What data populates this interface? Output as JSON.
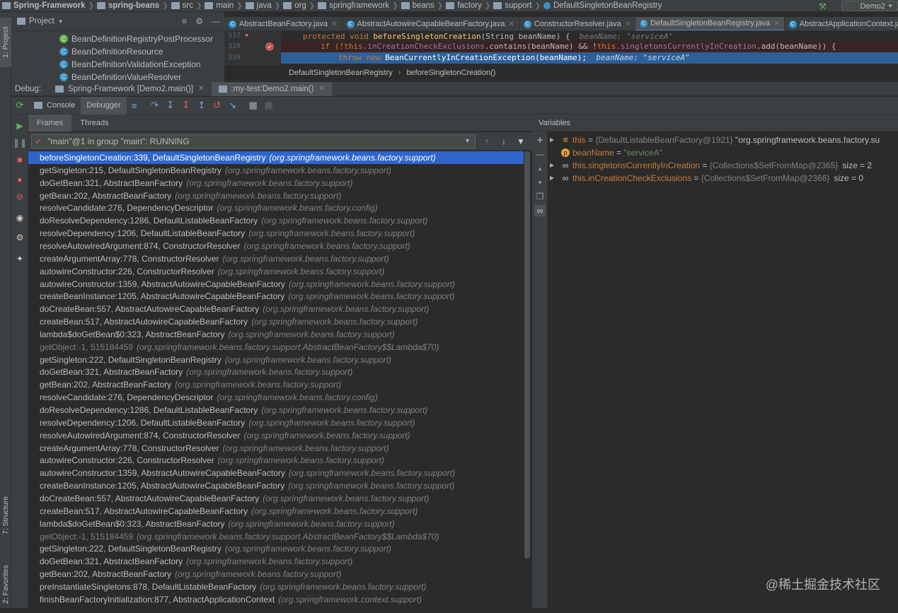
{
  "navbar": {
    "crumbs": [
      "Spring-Framework",
      "spring-beans",
      "src",
      "main",
      "java",
      "org",
      "springframework",
      "beans",
      "factory",
      "support",
      "DefaultSingletonBeanRegistry"
    ],
    "run_config": "Demo2"
  },
  "left_strip": {
    "project_tab": "1: Project",
    "structure_tab": "7: Structure",
    "favorites_tab": "2: Favorites"
  },
  "project": {
    "title": "Project",
    "tree": [
      {
        "label": "BeanDefinitionRegistryPostProcessor",
        "color": "#62b543"
      },
      {
        "label": "BeanDefinitionResource",
        "color": "#3592c4"
      },
      {
        "label": "BeanDefinitionValidationException",
        "color": "#3592c4"
      },
      {
        "label": "BeanDefinitionValueResolver",
        "color": "#3592c4"
      }
    ]
  },
  "tabs": [
    {
      "label": "AbstractBeanFactory.java"
    },
    {
      "label": "AbstractAutowireCapableBeanFactory.java"
    },
    {
      "label": "ConstructorResolver.java"
    },
    {
      "label": "DefaultSingletonBeanRegistry.java",
      "active": true
    },
    {
      "label": "AbstractApplicationContext.java"
    }
  ],
  "editor": {
    "lines": [
      {
        "num": "337",
        "text_kw": "protected void ",
        "text_fn": "beforeSingletonCreation",
        "text_rest": "(String beanName) {  ",
        "hint": "beanName: \"serviceA\""
      },
      {
        "num": "338",
        "part1": "if (!",
        "f1": "this",
        "f1b": ".inCreationCheckExclusions",
        "part2": ".contains(beanName) && !",
        "f2": "this",
        "f2b": ".singletonsCurrentlyInCreation",
        "part3": ".add(beanName)) {"
      },
      {
        "num": "339",
        "kw": "throw new ",
        "rest": "BeanCurrentlyInCreationException(beanName);  ",
        "hint": "beanName: \"serviceA\""
      }
    ],
    "breadcrumb": [
      "DefaultSingletonBeanRegistry",
      "beforeSingletonCreation()"
    ]
  },
  "debug": {
    "label": "Debug:",
    "sessions": [
      {
        "label": "Spring-Framework [Demo2.main()]"
      },
      {
        "label": ":my-test:Demo2.main()"
      }
    ],
    "toolbar": {
      "console": "Console",
      "debugger": "Debugger"
    },
    "frames_tab": "Frames",
    "threads_tab": "Threads",
    "thread": "\"main\"@1 in group \"main\": RUNNING",
    "frames": [
      {
        "m": "beforeSingletonCreation:339, DefaultSingletonBeanRegistry",
        "p": "(org.springframework.beans.factory.support)",
        "sel": true
      },
      {
        "m": "getSingleton:215, DefaultSingletonBeanRegistry",
        "p": "(org.springframework.beans.factory.support)"
      },
      {
        "m": "doGetBean:321, AbstractBeanFactory",
        "p": "(org.springframework.beans.factory.support)"
      },
      {
        "m": "getBean:202, AbstractBeanFactory",
        "p": "(org.springframework.beans.factory.support)"
      },
      {
        "m": "resolveCandidate:276, DependencyDescriptor",
        "p": "(org.springframework.beans.factory.config)"
      },
      {
        "m": "doResolveDependency:1286, DefaultListableBeanFactory",
        "p": "(org.springframework.beans.factory.support)"
      },
      {
        "m": "resolveDependency:1206, DefaultListableBeanFactory",
        "p": "(org.springframework.beans.factory.support)"
      },
      {
        "m": "resolveAutowiredArgument:874, ConstructorResolver",
        "p": "(org.springframework.beans.factory.support)"
      },
      {
        "m": "createArgumentArray:778, ConstructorResolver",
        "p": "(org.springframework.beans.factory.support)"
      },
      {
        "m": "autowireConstructor:226, ConstructorResolver",
        "p": "(org.springframework.beans.factory.support)"
      },
      {
        "m": "autowireConstructor:1359, AbstractAutowireCapableBeanFactory",
        "p": "(org.springframework.beans.factory.support)"
      },
      {
        "m": "createBeanInstance:1205, AbstractAutowireCapableBeanFactory",
        "p": "(org.springframework.beans.factory.support)"
      },
      {
        "m": "doCreateBean:557, AbstractAutowireCapableBeanFactory",
        "p": "(org.springframework.beans.factory.support)"
      },
      {
        "m": "createBean:517, AbstractAutowireCapableBeanFactory",
        "p": "(org.springframework.beans.factory.support)"
      },
      {
        "m": "lambda$doGetBean$0:323, AbstractBeanFactory",
        "p": "(org.springframework.beans.factory.support)"
      },
      {
        "m": "getObject:-1, 515184459",
        "p": "(org.springframework.beans.factory.support.AbstractBeanFactory$$Lambda$70)",
        "dim": true
      },
      {
        "m": "getSingleton:222, DefaultSingletonBeanRegistry",
        "p": "(org.springframework.beans.factory.support)"
      },
      {
        "m": "doGetBean:321, AbstractBeanFactory",
        "p": "(org.springframework.beans.factory.support)"
      },
      {
        "m": "getBean:202, AbstractBeanFactory",
        "p": "(org.springframework.beans.factory.support)"
      },
      {
        "m": "resolveCandidate:276, DependencyDescriptor",
        "p": "(org.springframework.beans.factory.config)"
      },
      {
        "m": "doResolveDependency:1286, DefaultListableBeanFactory",
        "p": "(org.springframework.beans.factory.support)"
      },
      {
        "m": "resolveDependency:1206, DefaultListableBeanFactory",
        "p": "(org.springframework.beans.factory.support)"
      },
      {
        "m": "resolveAutowiredArgument:874, ConstructorResolver",
        "p": "(org.springframework.beans.factory.support)"
      },
      {
        "m": "createArgumentArray:778, ConstructorResolver",
        "p": "(org.springframework.beans.factory.support)"
      },
      {
        "m": "autowireConstructor:226, ConstructorResolver",
        "p": "(org.springframework.beans.factory.support)"
      },
      {
        "m": "autowireConstructor:1359, AbstractAutowireCapableBeanFactory",
        "p": "(org.springframework.beans.factory.support)"
      },
      {
        "m": "createBeanInstance:1205, AbstractAutowireCapableBeanFactory",
        "p": "(org.springframework.beans.factory.support)"
      },
      {
        "m": "doCreateBean:557, AbstractAutowireCapableBeanFactory",
        "p": "(org.springframework.beans.factory.support)"
      },
      {
        "m": "createBean:517, AbstractAutowireCapableBeanFactory",
        "p": "(org.springframework.beans.factory.support)"
      },
      {
        "m": "lambda$doGetBean$0:323, AbstractBeanFactory",
        "p": "(org.springframework.beans.factory.support)"
      },
      {
        "m": "getObject:-1, 515184459",
        "p": "(org.springframework.beans.factory.support.AbstractBeanFactory$$Lambda$70)",
        "dim": true
      },
      {
        "m": "getSingleton:222, DefaultSingletonBeanRegistry",
        "p": "(org.springframework.beans.factory.support)"
      },
      {
        "m": "doGetBean:321, AbstractBeanFactory",
        "p": "(org.springframework.beans.factory.support)"
      },
      {
        "m": "getBean:202, AbstractBeanFactory",
        "p": "(org.springframework.beans.factory.support)"
      },
      {
        "m": "preInstantiateSingletons:878, DefaultListableBeanFactory",
        "p": "(org.springframework.beans.factory.support)"
      },
      {
        "m": "finishBeanFactoryInitialization:877, AbstractApplicationContext",
        "p": "(org.springframework.context.support)"
      }
    ],
    "variables_title": "Variables",
    "variables": [
      {
        "name": "this",
        "eq": " = ",
        "ref": "{DefaultListableBeanFactory@1921}",
        "val": " \"org.springframework.beans.factory.su",
        "kind": "field"
      },
      {
        "name": "beanName",
        "eq": " = ",
        "val": "\"serviceA\"",
        "kind": "param"
      },
      {
        "name": "this.singletonsCurrentlyInCreation",
        "eq": " = ",
        "ref": "{Collections$SetFromMap@2365}",
        "size": "size = 2",
        "kind": "watch"
      },
      {
        "name": "this.inCreationCheckExclusions",
        "eq": " = ",
        "ref": "{Collections$SetFromMap@2366}",
        "size": "size = 0",
        "kind": "watch"
      }
    ]
  },
  "watermark": "@稀土掘金技术社区"
}
